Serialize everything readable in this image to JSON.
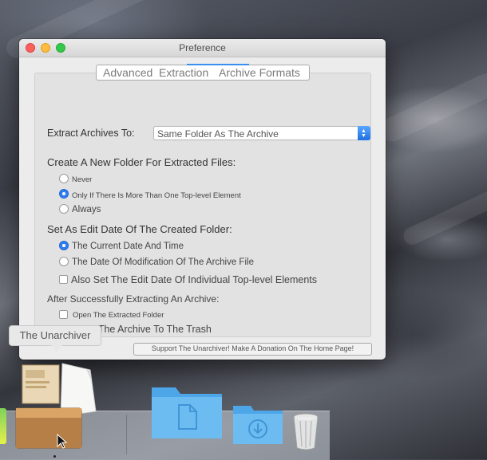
{
  "window": {
    "title": "Preference"
  },
  "tabs": [
    {
      "label": "Advanced"
    },
    {
      "label": "Extraction"
    },
    {
      "label": "Archive Formats"
    }
  ],
  "extract_to": {
    "label": "Extract Archives To:",
    "value": "Same Folder As The Archive"
  },
  "new_folder": {
    "heading": "Create A New Folder For Extracted Files:",
    "options": [
      {
        "label": "Never",
        "selected": false
      },
      {
        "label": "Only If There Is More Than One Top-level Element",
        "selected": true
      },
      {
        "label": "Always",
        "selected": false
      }
    ]
  },
  "edit_date": {
    "heading": "Set As Edit Date Of The Created Folder:",
    "options": [
      {
        "label": "The Current Date And Time",
        "selected": true
      },
      {
        "label": "The Date Of Modification Of The Archive File",
        "selected": false
      }
    ],
    "also_set": {
      "label": "Also Set The Edit Date Of Individual Top-level Elements",
      "checked": false
    }
  },
  "after_extract": {
    "heading": "After Successfully Extracting An Archive:",
    "open_folder": {
      "label": "Open The Extracted Folder",
      "checked": false
    },
    "move_trash": {
      "label": "Move The Archive To The Trash",
      "checked": false
    }
  },
  "donate_button": {
    "label": "Support The Unarchiver! Make A Donation On The Home Page!"
  },
  "dock": {
    "tooltip": "The Unarchiver",
    "items": [
      {
        "icon": "unarchiver-icon"
      },
      {
        "icon": "documents-folder-icon"
      },
      {
        "icon": "downloads-folder-icon"
      },
      {
        "icon": "trash-icon"
      }
    ]
  },
  "colors": {
    "accent": "#2f7ef2",
    "folder_blue": "#5cb3f0"
  }
}
